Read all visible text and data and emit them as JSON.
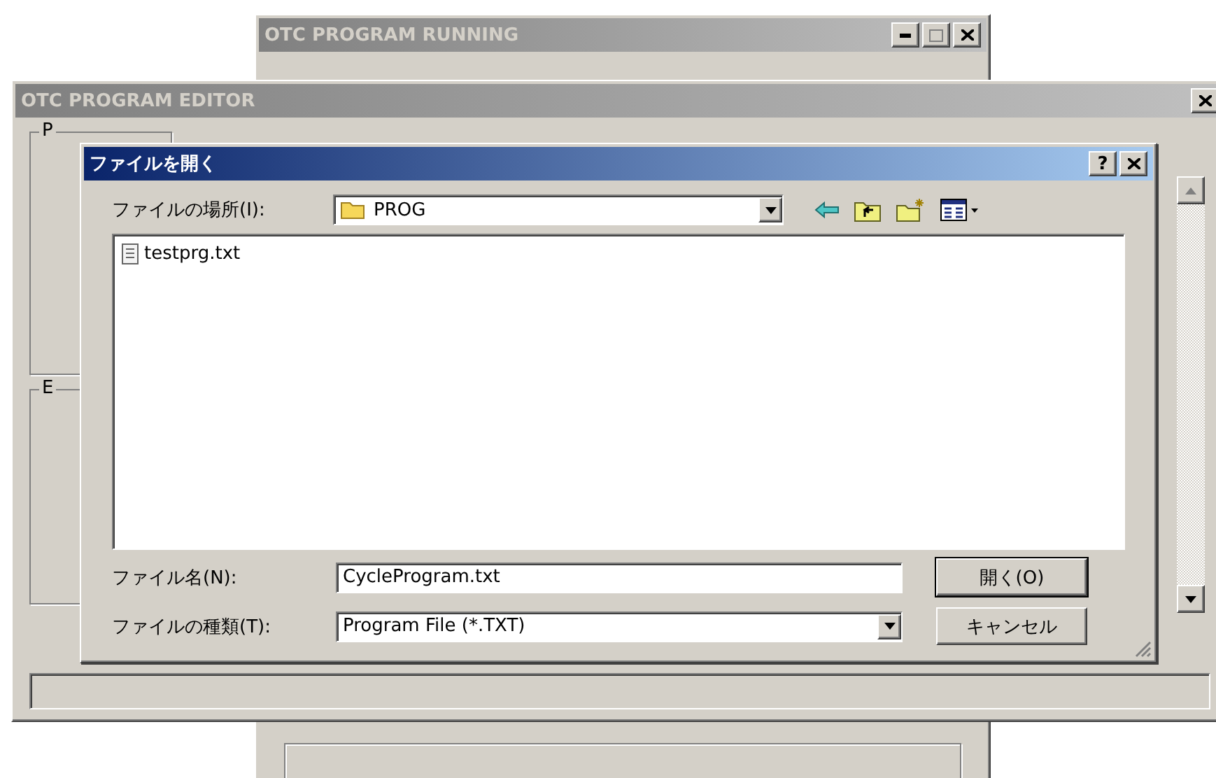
{
  "running_window": {
    "title": "OTC PROGRAM RUNNING"
  },
  "editor_window": {
    "title": "OTC PROGRAM EDITOR",
    "groups": [
      {
        "label": "P"
      },
      {
        "label": "E"
      }
    ]
  },
  "open_dialog": {
    "title": "ファイルを開く",
    "help_button": "?",
    "look_in": {
      "label": "ファイルの場所(I):",
      "value": "PROG"
    },
    "files": [
      {
        "name": "testprg.txt"
      }
    ],
    "file_name": {
      "label": "ファイル名(N):",
      "value": "CycleProgram.txt"
    },
    "file_type": {
      "label": "ファイルの種類(T):",
      "value": "Program File (*.TXT)"
    },
    "buttons": [
      "開く(O)",
      "キャンセル"
    ]
  }
}
